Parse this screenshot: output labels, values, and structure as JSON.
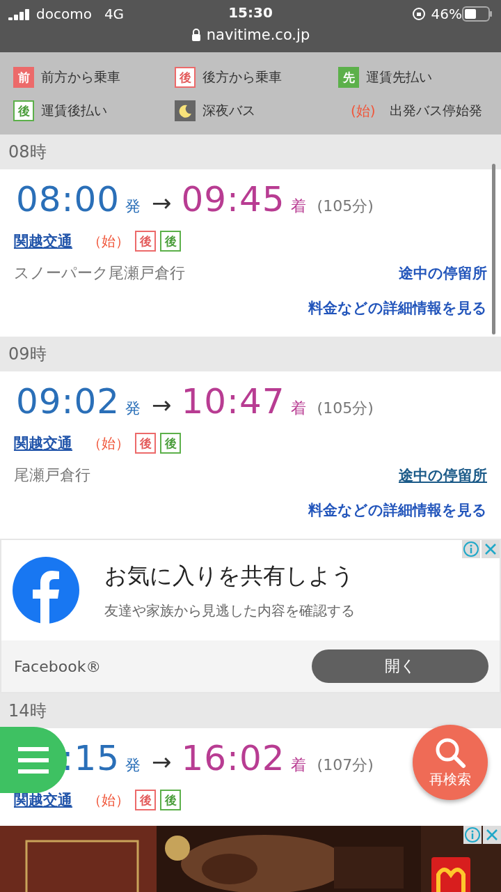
{
  "status_bar": {
    "carrier": "docomo",
    "network": "4G",
    "time": "15:30",
    "battery": "46%",
    "url": "navitime.co.jp"
  },
  "legend": [
    {
      "kind": "front",
      "mark": "前",
      "label": "前方から乗車"
    },
    {
      "kind": "rear",
      "mark": "後",
      "label": "後方から乗車"
    },
    {
      "kind": "prepay",
      "mark": "先",
      "label": "運賃先払い"
    },
    {
      "kind": "postpay",
      "mark": "後",
      "label": "運賃後払い"
    },
    {
      "kind": "night",
      "label": "深夜バス"
    },
    {
      "kind": "origin",
      "mark": "(始)",
      "label": "出発バス停始発"
    }
  ],
  "sections": [
    {
      "hour": "08時",
      "journeys": [
        {
          "departure": "08:00",
          "dep_suffix": "発",
          "arrow": "→",
          "arrival": "09:45",
          "arr_suffix": "着",
          "duration": "(105分)",
          "company": "関越交通",
          "origin": "（始）",
          "badges": [
            {
              "kind": "rear",
              "text": "後"
            },
            {
              "kind": "postpay",
              "text": "後"
            }
          ],
          "destination": "スノーパーク尾瀬戸倉行",
          "stops_link": {
            "text": "途中の停留所",
            "underlined": false
          },
          "details_link": "料金などの詳細情報を見る"
        }
      ]
    },
    {
      "hour": "09時",
      "journeys": [
        {
          "departure": "09:02",
          "dep_suffix": "発",
          "arrow": "→",
          "arrival": "10:47",
          "arr_suffix": "着",
          "duration": "(105分)",
          "company": "関越交通",
          "origin": "（始）",
          "badges": [
            {
              "kind": "rear",
              "text": "後"
            },
            {
              "kind": "postpay",
              "text": "後"
            }
          ],
          "destination": "尾瀬戸倉行",
          "stops_link": {
            "text": "途中の停留所",
            "underlined": true
          },
          "details_link": "料金などの詳細情報を見る"
        }
      ]
    },
    {
      "kind": "ad",
      "ad": {
        "title": "お気に入りを共有しよう",
        "subtitle": "友達や家族から見逃した内容を確認する",
        "advertiser": "Facebook®",
        "button": "開く"
      }
    },
    {
      "hour": "14時",
      "journeys": [
        {
          "departure": ":15",
          "dep_suffix": "発",
          "arrow": "→",
          "arrival": "16:02",
          "arr_suffix": "着",
          "duration": "(107分)",
          "company": "関越交通",
          "origin": "（始）",
          "badges": [
            {
              "kind": "rear",
              "text": "後"
            },
            {
              "kind": "postpay",
              "text": "後"
            }
          ]
        }
      ]
    }
  ],
  "search_button": {
    "label": "再検索"
  }
}
